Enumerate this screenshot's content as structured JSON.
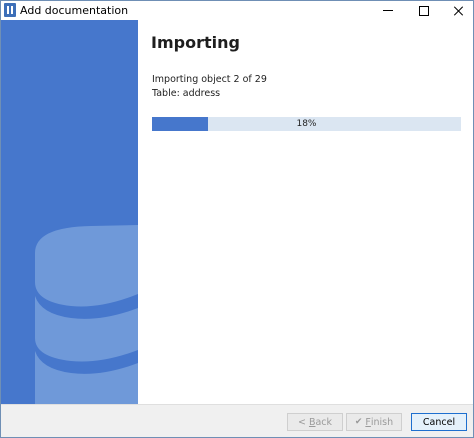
{
  "window": {
    "title": "Add documentation"
  },
  "main": {
    "heading": "Importing",
    "status_line": "Importing object 2 of 29",
    "table_line": "Table: address",
    "progress": {
      "percent": 18,
      "label": "18%"
    }
  },
  "footer": {
    "back": {
      "prefix": "< ",
      "mnemonic": "B",
      "rest": "ack",
      "enabled": false
    },
    "finish": {
      "mnemonic": "F",
      "rest": "inish",
      "enabled": false
    },
    "cancel": {
      "label": "Cancel",
      "enabled": true
    }
  },
  "colors": {
    "accent": "#4677cc",
    "progress_track": "#dbe6f2",
    "banner_shape": "#6f99d9"
  },
  "icons": [
    "app-icon",
    "minimize-icon",
    "maximize-icon",
    "close-icon",
    "database-icon",
    "chevron-left-icon",
    "check-icon"
  ]
}
